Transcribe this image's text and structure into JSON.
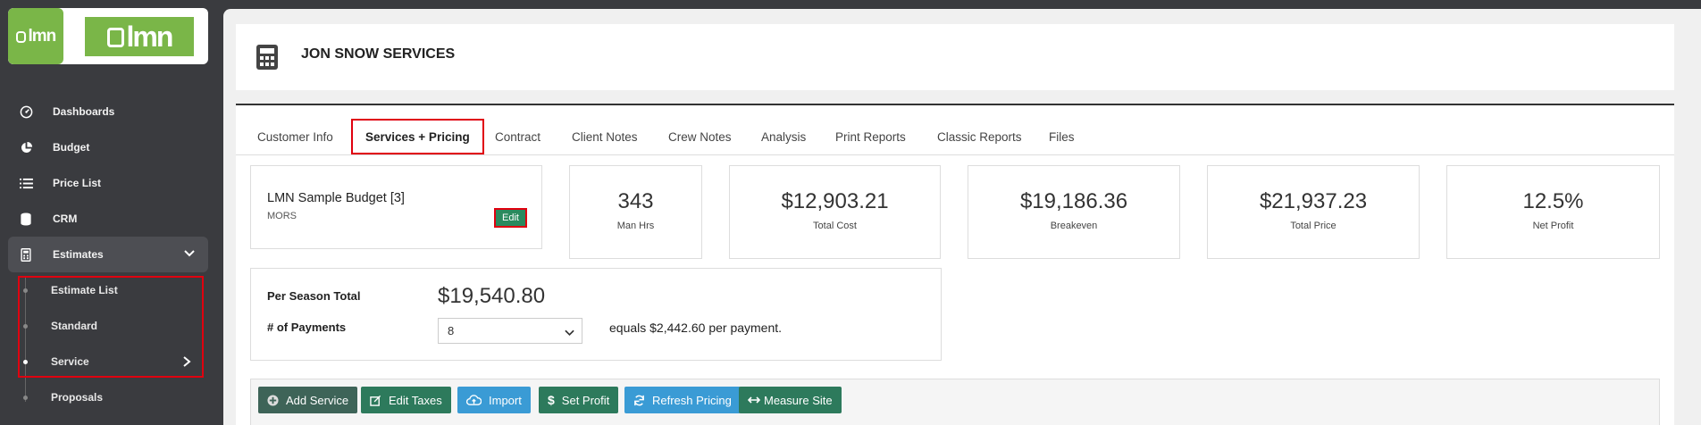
{
  "brand": {
    "logo_small": "lmn",
    "logo_large": "lmn"
  },
  "sidebar": {
    "items": [
      {
        "label": "Dashboards",
        "icon": "dashboard-gauge-icon"
      },
      {
        "label": "Budget",
        "icon": "pie-chart-icon"
      },
      {
        "label": "Price List",
        "icon": "list-icon"
      },
      {
        "label": "CRM",
        "icon": "database-icon"
      },
      {
        "label": "Estimates",
        "icon": "calculator-icon"
      }
    ],
    "sub_items": [
      {
        "label": "Estimate List"
      },
      {
        "label": "Standard"
      },
      {
        "label": "Service"
      },
      {
        "label": "Proposals"
      }
    ]
  },
  "header": {
    "title": "JON SNOW SERVICES",
    "icon": "calculator-icon"
  },
  "tabs": [
    {
      "label": "Customer Info"
    },
    {
      "label": "Services + Pricing"
    },
    {
      "label": "Contract"
    },
    {
      "label": "Client Notes"
    },
    {
      "label": "Crew Notes"
    },
    {
      "label": "Analysis"
    },
    {
      "label": "Print Reports"
    },
    {
      "label": "Classic Reports"
    },
    {
      "label": "Files"
    }
  ],
  "budget": {
    "title": "LMN Sample Budget [3]",
    "subtitle": "MORS",
    "edit_label": "Edit"
  },
  "stats": [
    {
      "value": "343",
      "label": "Man Hrs"
    },
    {
      "value": "$12,903.21",
      "label": "Total Cost"
    },
    {
      "value": "$19,186.36",
      "label": "Breakeven"
    },
    {
      "value": "$21,937.23",
      "label": "Total Price"
    },
    {
      "value": "12.5%",
      "label": "Net Profit"
    }
  ],
  "season": {
    "label": "Per Season Total",
    "value": "$19,540.80",
    "payments_label": "# of Payments",
    "payments_value": "8",
    "equals_text": "equals $2,442.60 per payment."
  },
  "toolbar": {
    "buttons": [
      {
        "label": "Add Service",
        "icon": "plus-circle-icon"
      },
      {
        "label": "Edit Taxes",
        "icon": "edit-icon"
      },
      {
        "label": "Import",
        "icon": "cloud-upload-icon"
      },
      {
        "label": "Set Profit",
        "icon": "dollar-icon"
      },
      {
        "label": "Refresh Pricing",
        "icon": "refresh-icon"
      },
      {
        "label": "Measure Site",
        "icon": "arrows-horizontal-icon"
      }
    ]
  },
  "colors": {
    "brand_green": "#7ab648",
    "button_green": "#2d7a5c",
    "button_blue": "#3a9bd5",
    "highlight_red": "#e0000f"
  }
}
